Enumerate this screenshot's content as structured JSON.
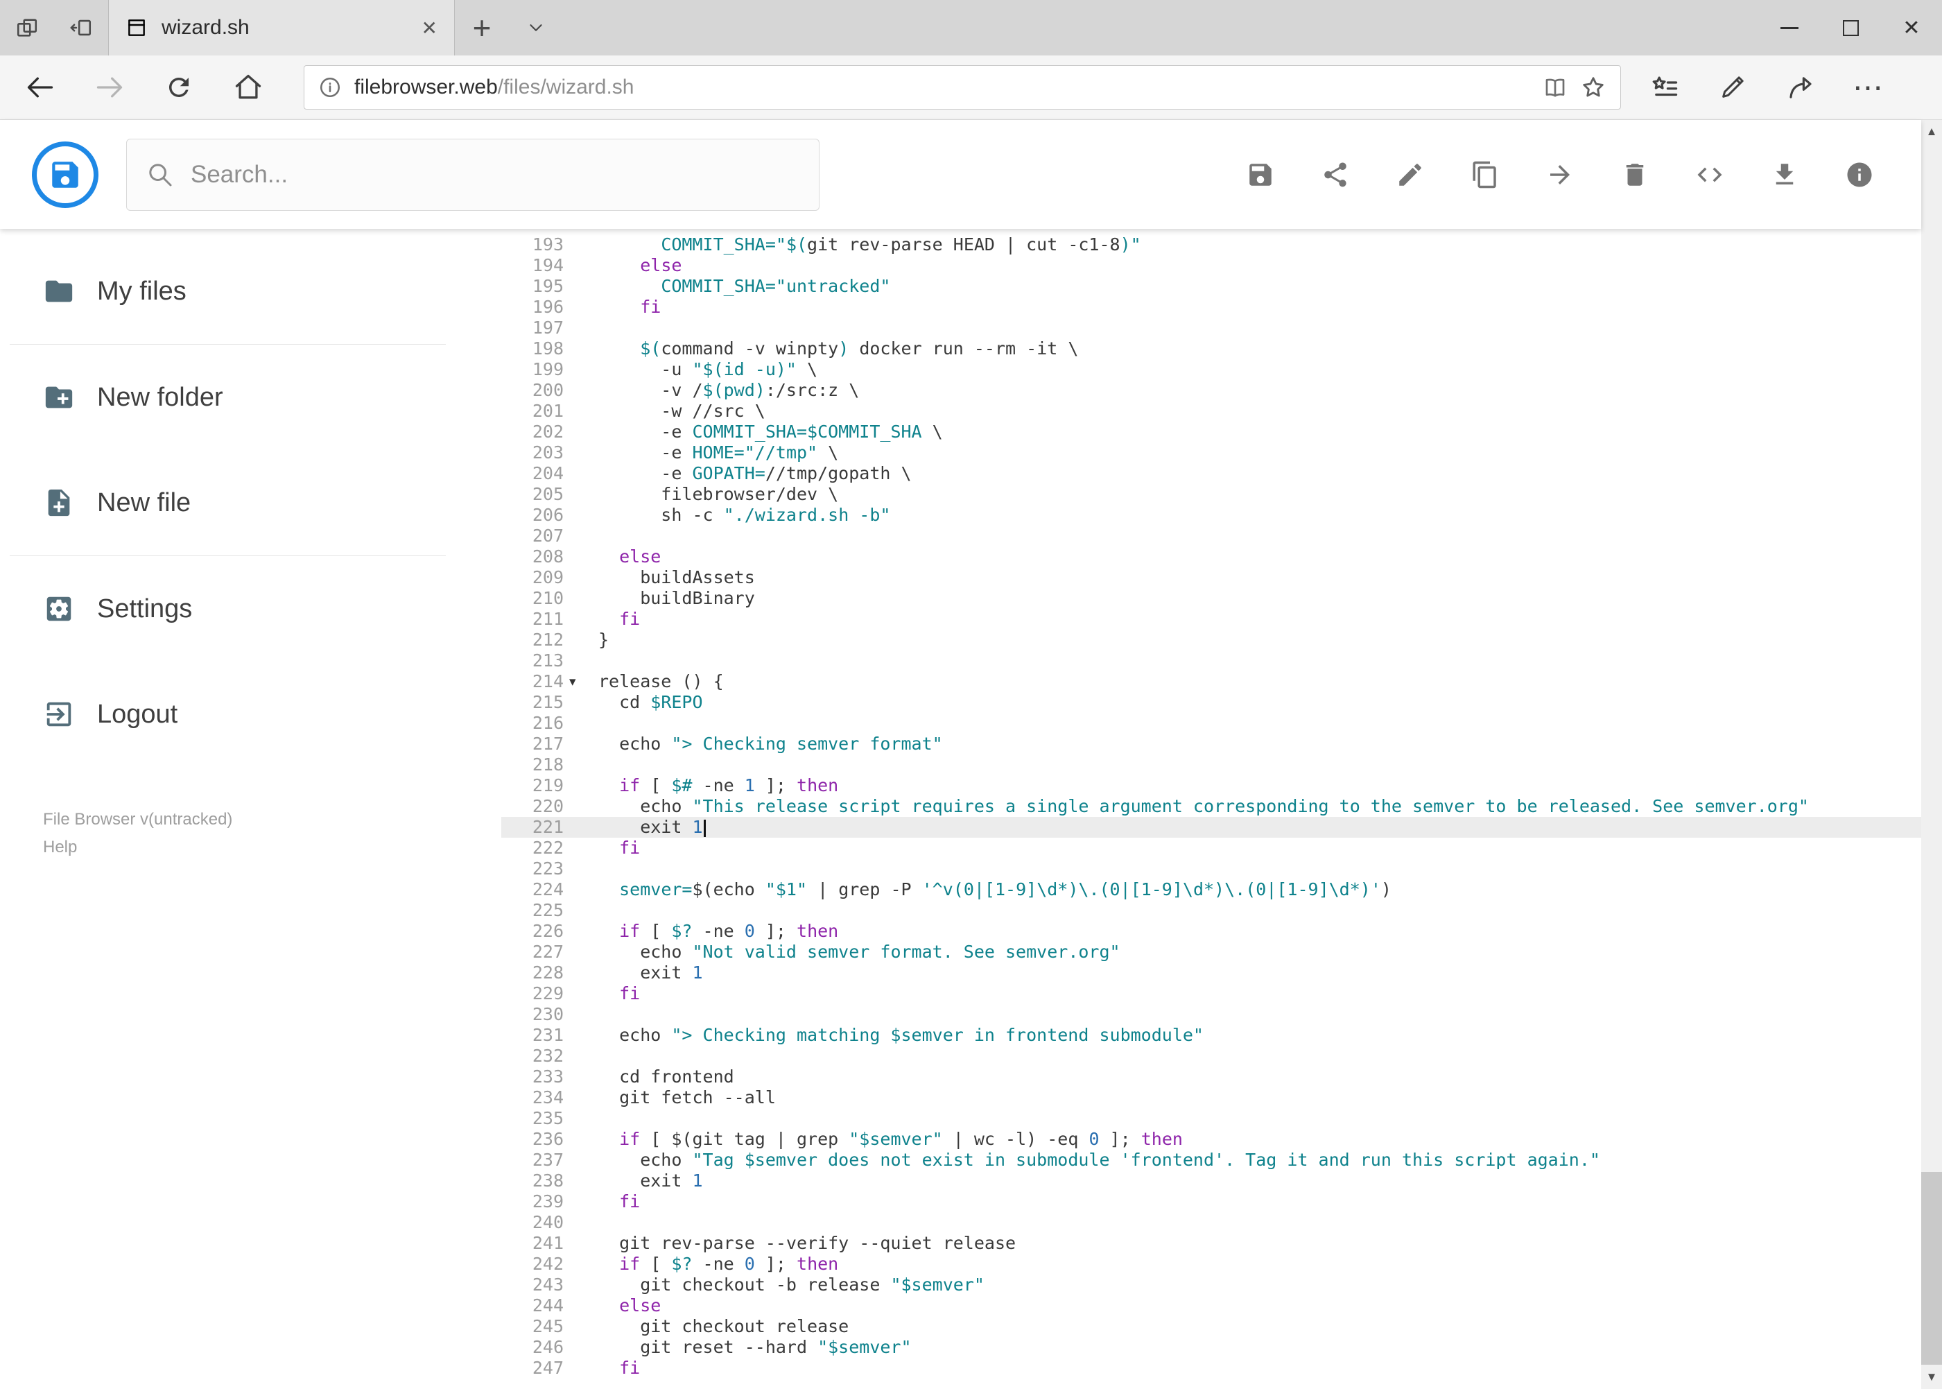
{
  "browser": {
    "tab": {
      "title": "wizard.sh"
    },
    "address": {
      "host": "filebrowser.web",
      "path": "/files/wizard.sh"
    }
  },
  "app": {
    "accent": "#1e88e5",
    "search_placeholder": "Search...",
    "toolbar": [
      {
        "id": "save",
        "icon": "save"
      },
      {
        "id": "share",
        "icon": "share"
      },
      {
        "id": "rename",
        "icon": "edit"
      },
      {
        "id": "copy",
        "icon": "copy"
      },
      {
        "id": "move",
        "icon": "forward"
      },
      {
        "id": "delete",
        "icon": "delete"
      },
      {
        "id": "source",
        "icon": "code"
      },
      {
        "id": "download",
        "icon": "download"
      },
      {
        "id": "info",
        "icon": "info"
      }
    ],
    "sidebar": {
      "items": [
        {
          "id": "my-files",
          "icon": "folder",
          "label": "My files",
          "divider_after": true
        },
        {
          "id": "new-folder",
          "icon": "new-folder",
          "label": "New folder"
        },
        {
          "id": "new-file",
          "icon": "new-file",
          "label": "New file",
          "divider_after": true
        },
        {
          "id": "settings",
          "icon": "settings",
          "label": "Settings"
        },
        {
          "id": "logout",
          "icon": "logout",
          "label": "Logout"
        }
      ],
      "credits": "File Browser v(untracked)",
      "help": "Help"
    }
  },
  "editor": {
    "active_line": 221,
    "cursor_line": 221,
    "colors": {
      "plain": "#3a3a3a",
      "keyword": "#8e24aa",
      "string": "#0e828c",
      "variable": "#0e828c",
      "number": "#2a6fb0",
      "line_number": "#9e9e9e"
    },
    "lines": [
      {
        "n": 193,
        "t": [
          [
            "p",
            "      "
          ],
          [
            "v",
            "COMMIT_SHA="
          ],
          [
            "s",
            "\"$("
          ],
          [
            "p",
            "git rev-parse HEAD | cut -c1-8"
          ],
          [
            "s",
            ")\""
          ]
        ]
      },
      {
        "n": 194,
        "t": [
          [
            "p",
            "    "
          ],
          [
            "k",
            "else"
          ]
        ]
      },
      {
        "n": 195,
        "t": [
          [
            "p",
            "      "
          ],
          [
            "v",
            "COMMIT_SHA="
          ],
          [
            "s",
            "\"untracked\""
          ]
        ]
      },
      {
        "n": 196,
        "t": [
          [
            "p",
            "    "
          ],
          [
            "k",
            "fi"
          ]
        ]
      },
      {
        "n": 197,
        "t": []
      },
      {
        "n": 198,
        "t": [
          [
            "p",
            "    "
          ],
          [
            "v",
            "$("
          ],
          [
            "p",
            "command -v winpty"
          ],
          [
            "v",
            ")"
          ],
          [
            "p",
            " docker run --rm -it \\"
          ]
        ]
      },
      {
        "n": 199,
        "t": [
          [
            "p",
            "      -u "
          ],
          [
            "s",
            "\"$(id -u)\""
          ],
          [
            "p",
            " \\"
          ]
        ]
      },
      {
        "n": 200,
        "t": [
          [
            "p",
            "      -v /"
          ],
          [
            "v",
            "$(pwd)"
          ],
          [
            "p",
            ":/src:z \\"
          ]
        ]
      },
      {
        "n": 201,
        "t": [
          [
            "p",
            "      -w //src \\"
          ]
        ]
      },
      {
        "n": 202,
        "t": [
          [
            "p",
            "      -e "
          ],
          [
            "v",
            "COMMIT_SHA=$COMMIT_SHA"
          ],
          [
            "p",
            " \\"
          ]
        ]
      },
      {
        "n": 203,
        "t": [
          [
            "p",
            "      -e "
          ],
          [
            "v",
            "HOME="
          ],
          [
            "s",
            "\"//tmp\""
          ],
          [
            "p",
            " \\"
          ]
        ]
      },
      {
        "n": 204,
        "t": [
          [
            "p",
            "      -e "
          ],
          [
            "v",
            "GOPATH="
          ],
          [
            "p",
            "//tmp/gopath \\"
          ]
        ]
      },
      {
        "n": 205,
        "t": [
          [
            "p",
            "      filebrowser/dev \\"
          ]
        ]
      },
      {
        "n": 206,
        "t": [
          [
            "p",
            "      sh -c "
          ],
          [
            "s",
            "\"./wizard.sh -b\""
          ]
        ]
      },
      {
        "n": 207,
        "t": []
      },
      {
        "n": 208,
        "t": [
          [
            "p",
            "  "
          ],
          [
            "k",
            "else"
          ]
        ]
      },
      {
        "n": 209,
        "t": [
          [
            "p",
            "    buildAssets"
          ]
        ]
      },
      {
        "n": 210,
        "t": [
          [
            "p",
            "    buildBinary"
          ]
        ]
      },
      {
        "n": 211,
        "t": [
          [
            "p",
            "  "
          ],
          [
            "k",
            "fi"
          ]
        ]
      },
      {
        "n": 212,
        "t": [
          [
            "p",
            "}"
          ]
        ]
      },
      {
        "n": 213,
        "t": []
      },
      {
        "n": 214,
        "fold": true,
        "t": [
          [
            "p",
            "release () {"
          ]
        ]
      },
      {
        "n": 215,
        "t": [
          [
            "p",
            "  cd "
          ],
          [
            "v",
            "$REPO"
          ]
        ]
      },
      {
        "n": 216,
        "t": []
      },
      {
        "n": 217,
        "t": [
          [
            "p",
            "  echo "
          ],
          [
            "s",
            "\"> Checking semver format\""
          ]
        ]
      },
      {
        "n": 218,
        "t": []
      },
      {
        "n": 219,
        "t": [
          [
            "p",
            "  "
          ],
          [
            "k",
            "if"
          ],
          [
            "p",
            " [ "
          ],
          [
            "v",
            "$#"
          ],
          [
            "p",
            " -ne "
          ],
          [
            "n",
            "1"
          ],
          [
            "p",
            " ]; "
          ],
          [
            "k",
            "then"
          ]
        ]
      },
      {
        "n": 220,
        "t": [
          [
            "p",
            "    echo "
          ],
          [
            "s",
            "\"This release script requires a single argument corresponding to the semver to be released. See semver.org\""
          ]
        ]
      },
      {
        "n": 221,
        "t": [
          [
            "p",
            "    exit "
          ],
          [
            "n",
            "1"
          ]
        ]
      },
      {
        "n": 222,
        "t": [
          [
            "p",
            "  "
          ],
          [
            "k",
            "fi"
          ]
        ]
      },
      {
        "n": 223,
        "t": []
      },
      {
        "n": 224,
        "t": [
          [
            "p",
            "  "
          ],
          [
            "v",
            "semver="
          ],
          [
            "p",
            "$(echo "
          ],
          [
            "s",
            "\"$1\""
          ],
          [
            "p",
            " | grep -P "
          ],
          [
            "s",
            "'^v(0|[1-9]\\d*)\\.(0|[1-9]\\d*)\\.(0|[1-9]\\d*)'"
          ],
          [
            "p",
            ")"
          ]
        ]
      },
      {
        "n": 225,
        "t": []
      },
      {
        "n": 226,
        "t": [
          [
            "p",
            "  "
          ],
          [
            "k",
            "if"
          ],
          [
            "p",
            " [ "
          ],
          [
            "v",
            "$?"
          ],
          [
            "p",
            " -ne "
          ],
          [
            "n",
            "0"
          ],
          [
            "p",
            " ]; "
          ],
          [
            "k",
            "then"
          ]
        ]
      },
      {
        "n": 227,
        "t": [
          [
            "p",
            "    echo "
          ],
          [
            "s",
            "\"Not valid semver format. See semver.org\""
          ]
        ]
      },
      {
        "n": 228,
        "t": [
          [
            "p",
            "    exit "
          ],
          [
            "n",
            "1"
          ]
        ]
      },
      {
        "n": 229,
        "t": [
          [
            "p",
            "  "
          ],
          [
            "k",
            "fi"
          ]
        ]
      },
      {
        "n": 230,
        "t": []
      },
      {
        "n": 231,
        "t": [
          [
            "p",
            "  echo "
          ],
          [
            "s",
            "\"> Checking matching $semver in frontend submodule\""
          ]
        ]
      },
      {
        "n": 232,
        "t": []
      },
      {
        "n": 233,
        "t": [
          [
            "p",
            "  cd frontend"
          ]
        ]
      },
      {
        "n": 234,
        "t": [
          [
            "p",
            "  git fetch --all"
          ]
        ]
      },
      {
        "n": 235,
        "t": []
      },
      {
        "n": 236,
        "t": [
          [
            "p",
            "  "
          ],
          [
            "k",
            "if"
          ],
          [
            "p",
            " [ $(git tag | grep "
          ],
          [
            "s",
            "\"$semver\""
          ],
          [
            "p",
            " | wc -l) -eq "
          ],
          [
            "n",
            "0"
          ],
          [
            "p",
            " ]; "
          ],
          [
            "k",
            "then"
          ]
        ]
      },
      {
        "n": 237,
        "t": [
          [
            "p",
            "    echo "
          ],
          [
            "s",
            "\"Tag $semver does not exist in submodule 'frontend'. Tag it and run this script again.\""
          ]
        ]
      },
      {
        "n": 238,
        "t": [
          [
            "p",
            "    exit "
          ],
          [
            "n",
            "1"
          ]
        ]
      },
      {
        "n": 239,
        "t": [
          [
            "p",
            "  "
          ],
          [
            "k",
            "fi"
          ]
        ]
      },
      {
        "n": 240,
        "t": []
      },
      {
        "n": 241,
        "t": [
          [
            "p",
            "  git rev-parse --verify --quiet release"
          ]
        ]
      },
      {
        "n": 242,
        "t": [
          [
            "p",
            "  "
          ],
          [
            "k",
            "if"
          ],
          [
            "p",
            " [ "
          ],
          [
            "v",
            "$?"
          ],
          [
            "p",
            " -ne "
          ],
          [
            "n",
            "0"
          ],
          [
            "p",
            " ]; "
          ],
          [
            "k",
            "then"
          ]
        ]
      },
      {
        "n": 243,
        "t": [
          [
            "p",
            "    git checkout -b release "
          ],
          [
            "s",
            "\"$semver\""
          ]
        ]
      },
      {
        "n": 244,
        "t": [
          [
            "p",
            "  "
          ],
          [
            "k",
            "else"
          ]
        ]
      },
      {
        "n": 245,
        "t": [
          [
            "p",
            "    git checkout release"
          ]
        ]
      },
      {
        "n": 246,
        "t": [
          [
            "p",
            "    git reset --hard "
          ],
          [
            "s",
            "\"$semver\""
          ]
        ]
      },
      {
        "n": 247,
        "t": [
          [
            "p",
            "  "
          ],
          [
            "k",
            "fi"
          ]
        ]
      }
    ]
  }
}
